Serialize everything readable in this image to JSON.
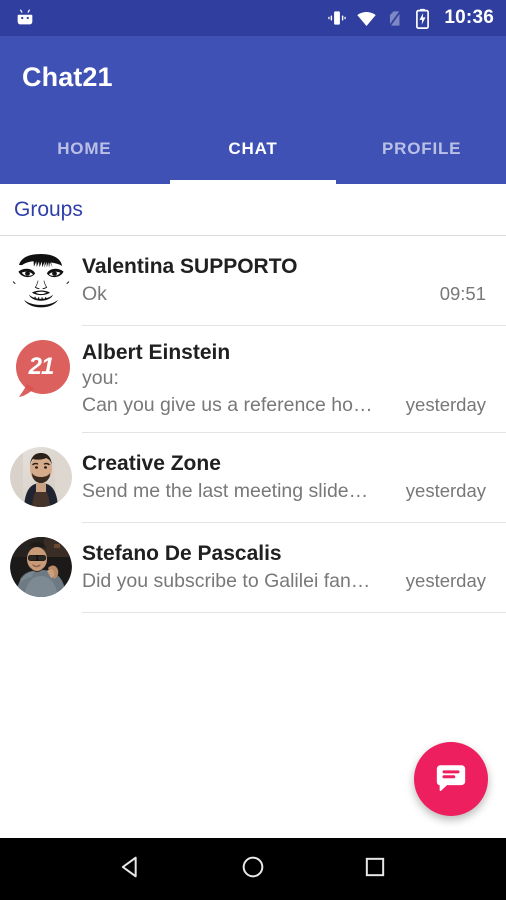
{
  "status_bar": {
    "app_icon": "android-head-icon",
    "icons": [
      "vibrate-icon",
      "wifi-icon",
      "no-sim-icon",
      "battery-charging-icon"
    ],
    "clock": "10:36",
    "background": "#303F9F"
  },
  "app_bar": {
    "title": "Chat21",
    "background": "#3F51B5"
  },
  "tabs": [
    {
      "label": "HOME",
      "active": false
    },
    {
      "label": "CHAT",
      "active": true
    },
    {
      "label": "PROFILE",
      "active": false
    }
  ],
  "section": {
    "label": "Groups",
    "color": "#2f3fa8"
  },
  "chats": [
    {
      "name": "Valentina SUPPORTO",
      "prefix": "",
      "snippet": "Ok",
      "time": "09:51",
      "avatar": "face-line-art-avatar"
    },
    {
      "name": "Albert Einstein",
      "prefix": "you:",
      "snippet": "Can you give us a reference ho…",
      "time": "yesterday",
      "avatar": "chat21-badge-avatar",
      "badge": "21"
    },
    {
      "name": "Creative Zone",
      "prefix": "",
      "snippet": "Send me the last meeting slide…",
      "time": "yesterday",
      "avatar": "bearded-man-photo-avatar"
    },
    {
      "name": "Stefano De Pascalis",
      "prefix": "",
      "snippet": "Did you subscribe to Galilei fan…",
      "time": "yesterday",
      "avatar": "man-sunglasses-photo-avatar"
    }
  ],
  "fab": {
    "icon": "new-chat-icon",
    "color": "#ee1f5f"
  },
  "nav_bar": {
    "back": "back-triangle-icon",
    "home": "home-circle-icon",
    "recents": "recents-square-icon"
  }
}
